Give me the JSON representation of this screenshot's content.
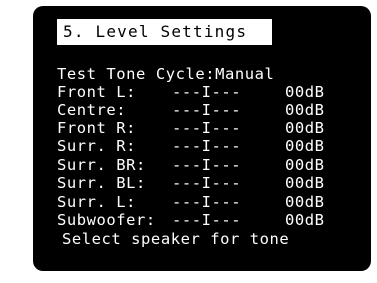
{
  "screen": {
    "title": "5. Level Settings",
    "test_tone_cycle": "Test Tone Cycle:Manual",
    "channels": [
      {
        "label": "Front L:",
        "bar": "---I---",
        "level": "00dB"
      },
      {
        "label": "Centre:",
        "bar": "---I---",
        "level": "00dB"
      },
      {
        "label": "Front R:",
        "bar": "---I---",
        "level": "00dB"
      },
      {
        "label": "Surr. R:",
        "bar": "---I---",
        "level": "00dB"
      },
      {
        "label": "Surr. BR:",
        "bar": "---I---",
        "level": "00dB"
      },
      {
        "label": "Surr. BL:",
        "bar": "---I---",
        "level": "00dB"
      },
      {
        "label": "Surr. L:",
        "bar": "---I---",
        "level": "00dB"
      },
      {
        "label": "Subwoofer:",
        "bar": "---I---",
        "level": "00dB"
      }
    ],
    "footer": "Select speaker for tone"
  },
  "colors": {
    "background": "#000000",
    "text": "#ffffff",
    "title_bg": "#ffffff",
    "title_text": "#000000"
  }
}
